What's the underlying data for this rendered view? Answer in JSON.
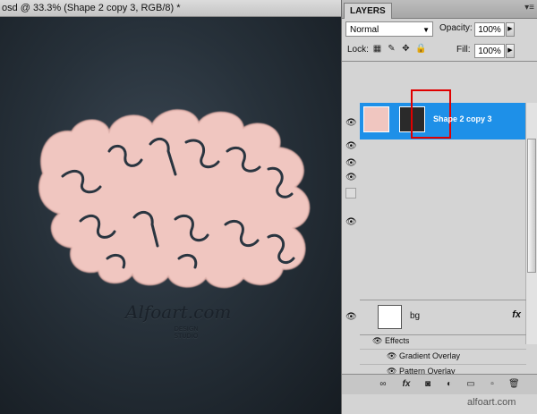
{
  "document": {
    "title": "osd @ 33.3% (Shape 2 copy 3, RGB/8) *",
    "watermark_logo": "Alfoart.com",
    "watermark_sub_line1": "DESIGN",
    "watermark_sub_line2": "STUDIO"
  },
  "layers_panel": {
    "tab_label": "LAYERS",
    "menu_icon": "panel-menu-icon",
    "blend_mode": "Normal",
    "opacity_label": "Opacity:",
    "opacity_value": "100%",
    "lock_label": "Lock:",
    "fill_label": "Fill:",
    "fill_value": "100%",
    "selected_layer": "Shape 2 copy 3",
    "bg_layer": "bg",
    "effects_label": "Effects",
    "effects": [
      "Gradient Overlay",
      "Pattern Overlay"
    ],
    "footer_icons": [
      "link-icon",
      "fx-icon",
      "mask-icon",
      "adjustment-icon",
      "group-icon",
      "new-layer-icon",
      "trash-icon"
    ]
  },
  "credit": "alfoart.com",
  "colors": {
    "selection": "#1e90e8",
    "shape_fill": "#f0c6c0",
    "highlight": "#e00000"
  }
}
